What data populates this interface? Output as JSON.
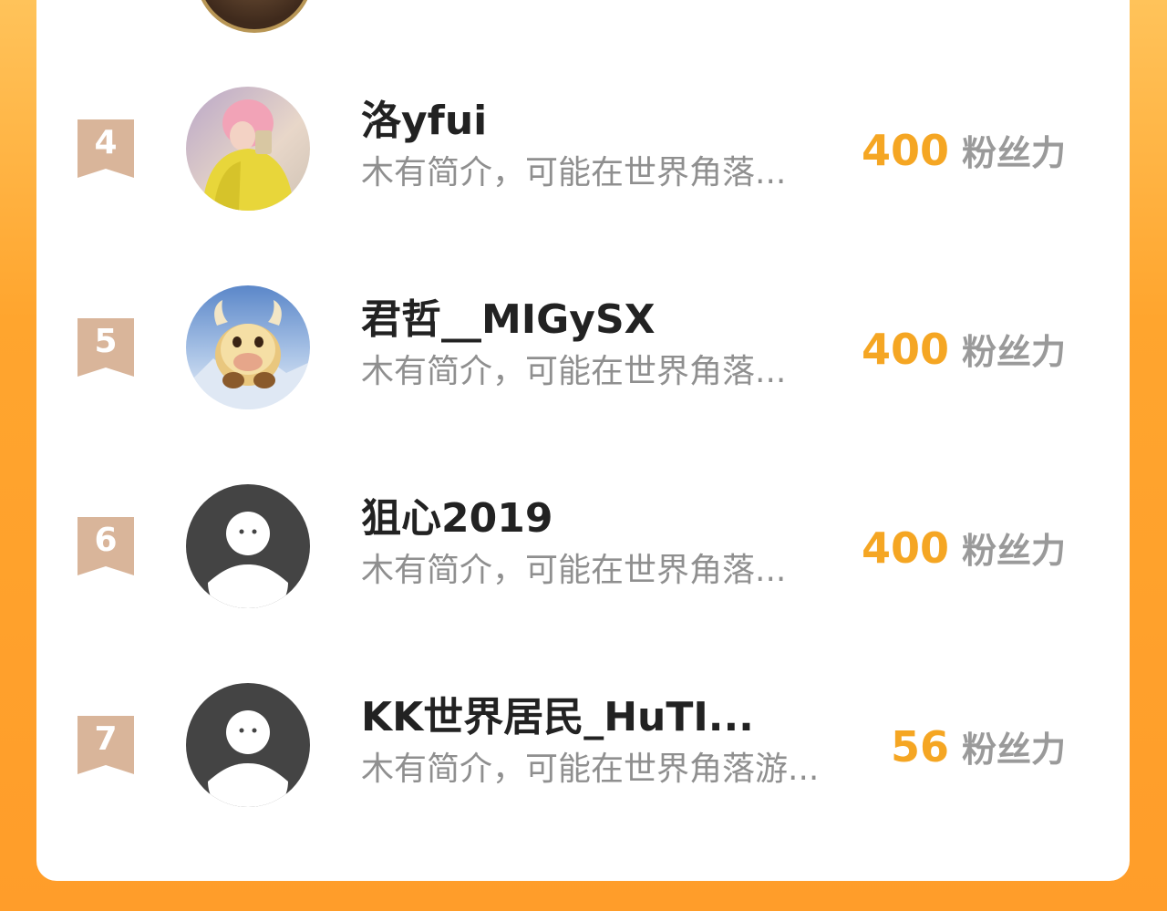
{
  "colors": {
    "background_accent": "#ff9d2a",
    "fans_value": "#f5a623",
    "rank_badge": "#d9b59a",
    "default_avatar": "#444444"
  },
  "leaderboard": {
    "rows": [
      {
        "rank": "4",
        "username": "洛yfui",
        "bio": "木有简介，可能在世界角落...",
        "fans_value": "400",
        "fans_unit": "粉丝力",
        "avatar": "photo-avatar-pink-hair"
      },
      {
        "rank": "5",
        "username": "君哲__MIGySX",
        "bio": "木有简介，可能在世界角落...",
        "fans_value": "400",
        "fans_unit": "粉丝力",
        "avatar": "photo-avatar-cartoon-bull"
      },
      {
        "rank": "6",
        "username": "狙心2019",
        "bio": "木有简介，可能在世界角落...",
        "fans_value": "400",
        "fans_unit": "粉丝力",
        "avatar": "default-avatar-icon"
      },
      {
        "rank": "7",
        "username": "KK世界居民_HuTI...",
        "bio": "木有简介，可能在世界角落游...",
        "fans_value": "56",
        "fans_unit": "粉丝力",
        "avatar": "default-avatar-icon"
      }
    ]
  }
}
